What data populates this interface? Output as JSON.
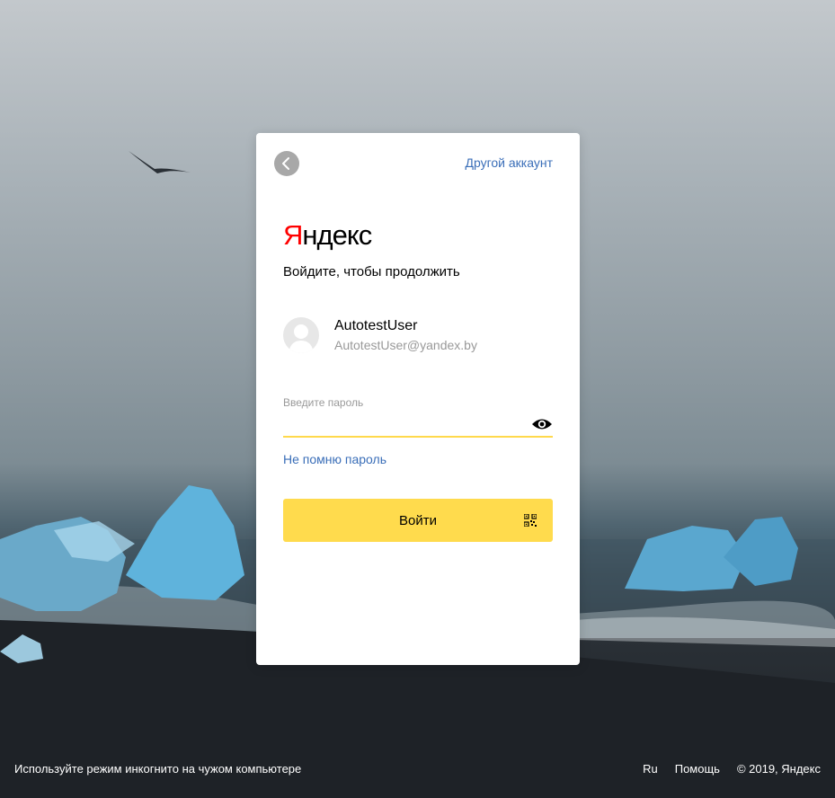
{
  "header": {
    "back_icon": "chevron-left-icon",
    "other_account_label": "Другой аккаунт"
  },
  "logo": {
    "first_letter": "Я",
    "rest": "ндекс",
    "accent_color": "#ff0000"
  },
  "subtitle": "Войдите, чтобы продолжить",
  "account": {
    "avatar_icon": "user-avatar-icon",
    "name": "AutotestUser",
    "email": "AutotestUser@yandex.by"
  },
  "password": {
    "label": "Введите пароль",
    "value": "",
    "show_icon": "eye-icon",
    "underline_color": "#ffd94c"
  },
  "forgot_label": "Не помню пароль",
  "submit": {
    "label": "Войти",
    "qr_icon": "qr-code-icon",
    "color": "#ffdb4d"
  },
  "footer": {
    "incognito_hint": "Используйте режим инкогнито на чужом компьютере",
    "language": "Ru",
    "help": "Помощь",
    "copyright": "© 2019, Яндекс"
  }
}
